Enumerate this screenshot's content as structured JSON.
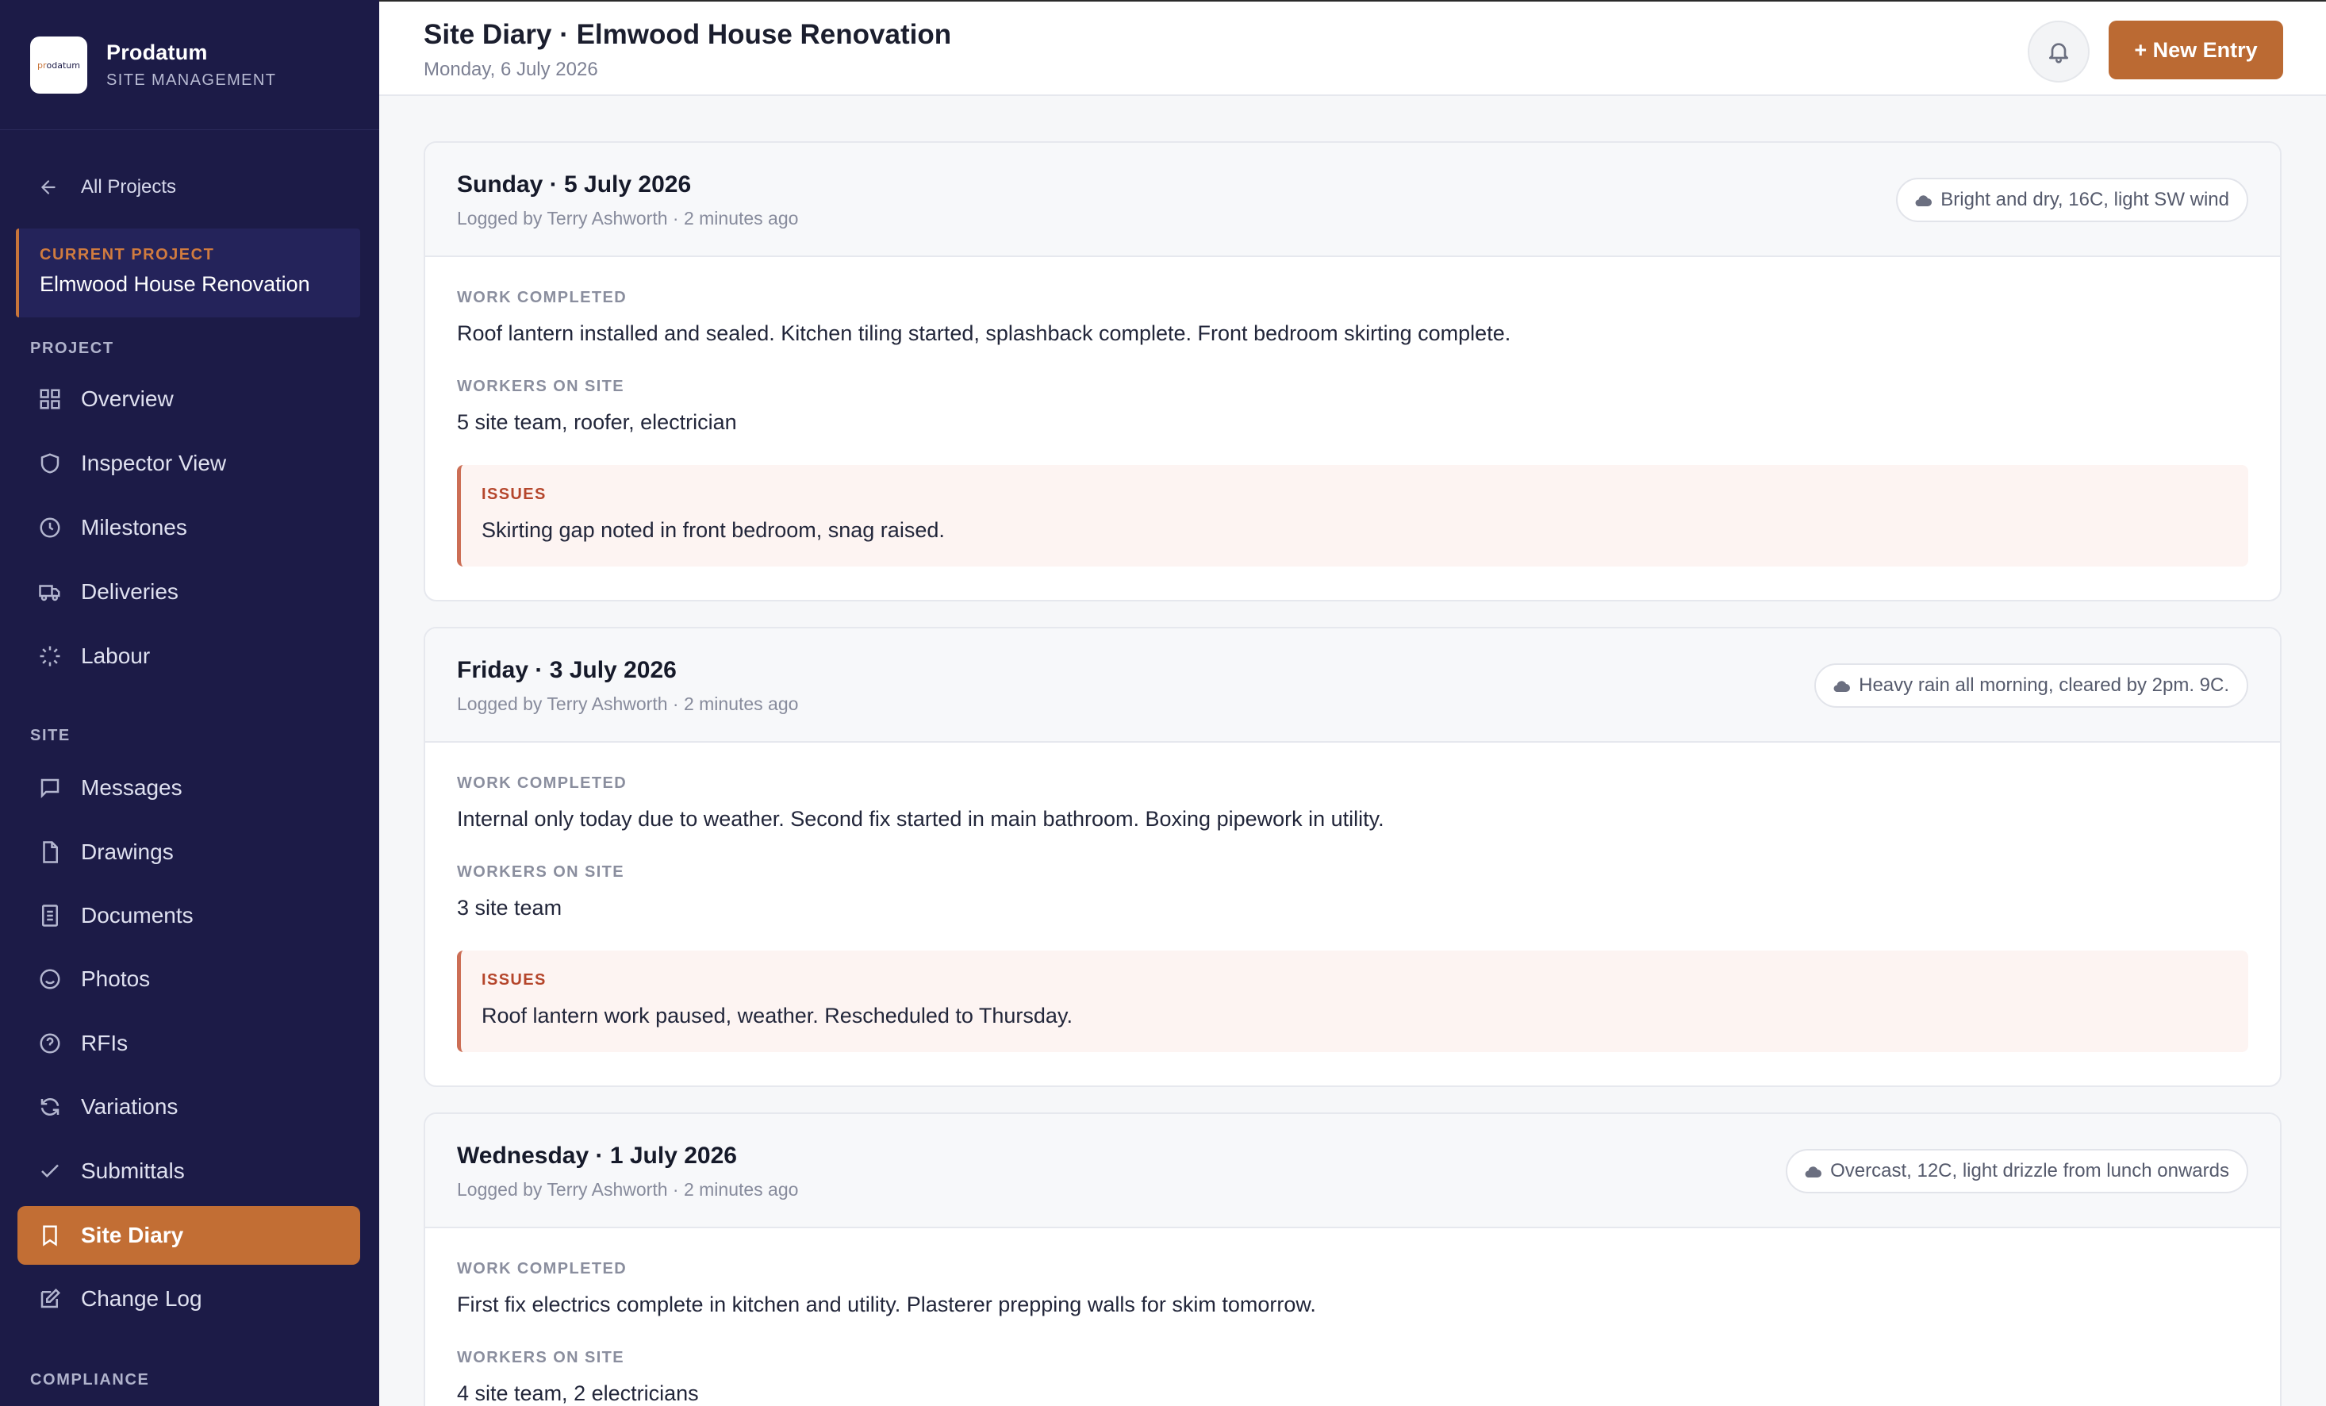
{
  "sidebar": {
    "brand": {
      "name": "Prodatum",
      "subtitle": "SITE MANAGEMENT",
      "logo_text_a": "pr",
      "logo_text_b": "odatum"
    },
    "back_label": "All Projects",
    "current_project": {
      "label": "CURRENT PROJECT",
      "name": "Elmwood House Renovation"
    },
    "sections": {
      "project": "PROJECT",
      "site": "SITE",
      "compliance": "COMPLIANCE"
    },
    "project_items": [
      {
        "label": "Overview",
        "icon": "grid-icon"
      },
      {
        "label": "Inspector View",
        "icon": "shield-icon"
      },
      {
        "label": "Milestones",
        "icon": "clock-icon"
      },
      {
        "label": "Deliveries",
        "icon": "truck-icon"
      },
      {
        "label": "Labour",
        "icon": "spinner-icon"
      }
    ],
    "site_items": [
      {
        "label": "Messages",
        "icon": "chat-icon"
      },
      {
        "label": "Drawings",
        "icon": "file-icon"
      },
      {
        "label": "Documents",
        "icon": "document-icon"
      },
      {
        "label": "Photos",
        "icon": "smile-icon"
      },
      {
        "label": "RFIs",
        "icon": "help-circle-icon"
      },
      {
        "label": "Variations",
        "icon": "refresh-icon"
      },
      {
        "label": "Submittals",
        "icon": "check-icon"
      },
      {
        "label": "Site Diary",
        "icon": "bookmark-icon",
        "active": true
      },
      {
        "label": "Change Log",
        "icon": "edit-icon"
      }
    ]
  },
  "header": {
    "title": "Site Diary · Elmwood House Renovation",
    "date": "Monday, 6 July 2026",
    "new_entry_label": "+ New Entry"
  },
  "labels": {
    "work_completed": "WORK COMPLETED",
    "workers_on_site": "WORKERS ON SITE",
    "issues": "ISSUES"
  },
  "entries": [
    {
      "date": "Sunday · 5 July 2026",
      "meta": "Logged by Terry Ashworth · 2 minutes ago",
      "weather": "Bright and dry, 16C, light SW wind",
      "work_completed": "Roof lantern installed and sealed. Kitchen tiling started, splashback complete. Front bedroom skirting complete.",
      "workers": "5 site team, roofer, electrician",
      "issues": "Skirting gap noted in front bedroom, snag raised."
    },
    {
      "date": "Friday · 3 July 2026",
      "meta": "Logged by Terry Ashworth · 2 minutes ago",
      "weather": "Heavy rain all morning, cleared by 2pm. 9C.",
      "work_completed": "Internal only today due to weather. Second fix started in main bathroom. Boxing pipework in utility.",
      "workers": "3 site team",
      "issues": "Roof lantern work paused, weather. Rescheduled to Thursday."
    },
    {
      "date": "Wednesday · 1 July 2026",
      "meta": "Logged by Terry Ashworth · 2 minutes ago",
      "weather": "Overcast, 12C, light drizzle from lunch onwards",
      "work_completed": "First fix electrics complete in kitchen and utility. Plasterer prepping walls for skim tomorrow.",
      "workers": "4 site team, 2 electricians"
    }
  ],
  "colors": {
    "sidebar_bg": "#1c1b47",
    "accent": "#c26e34",
    "issues_border": "#cc6e55"
  }
}
